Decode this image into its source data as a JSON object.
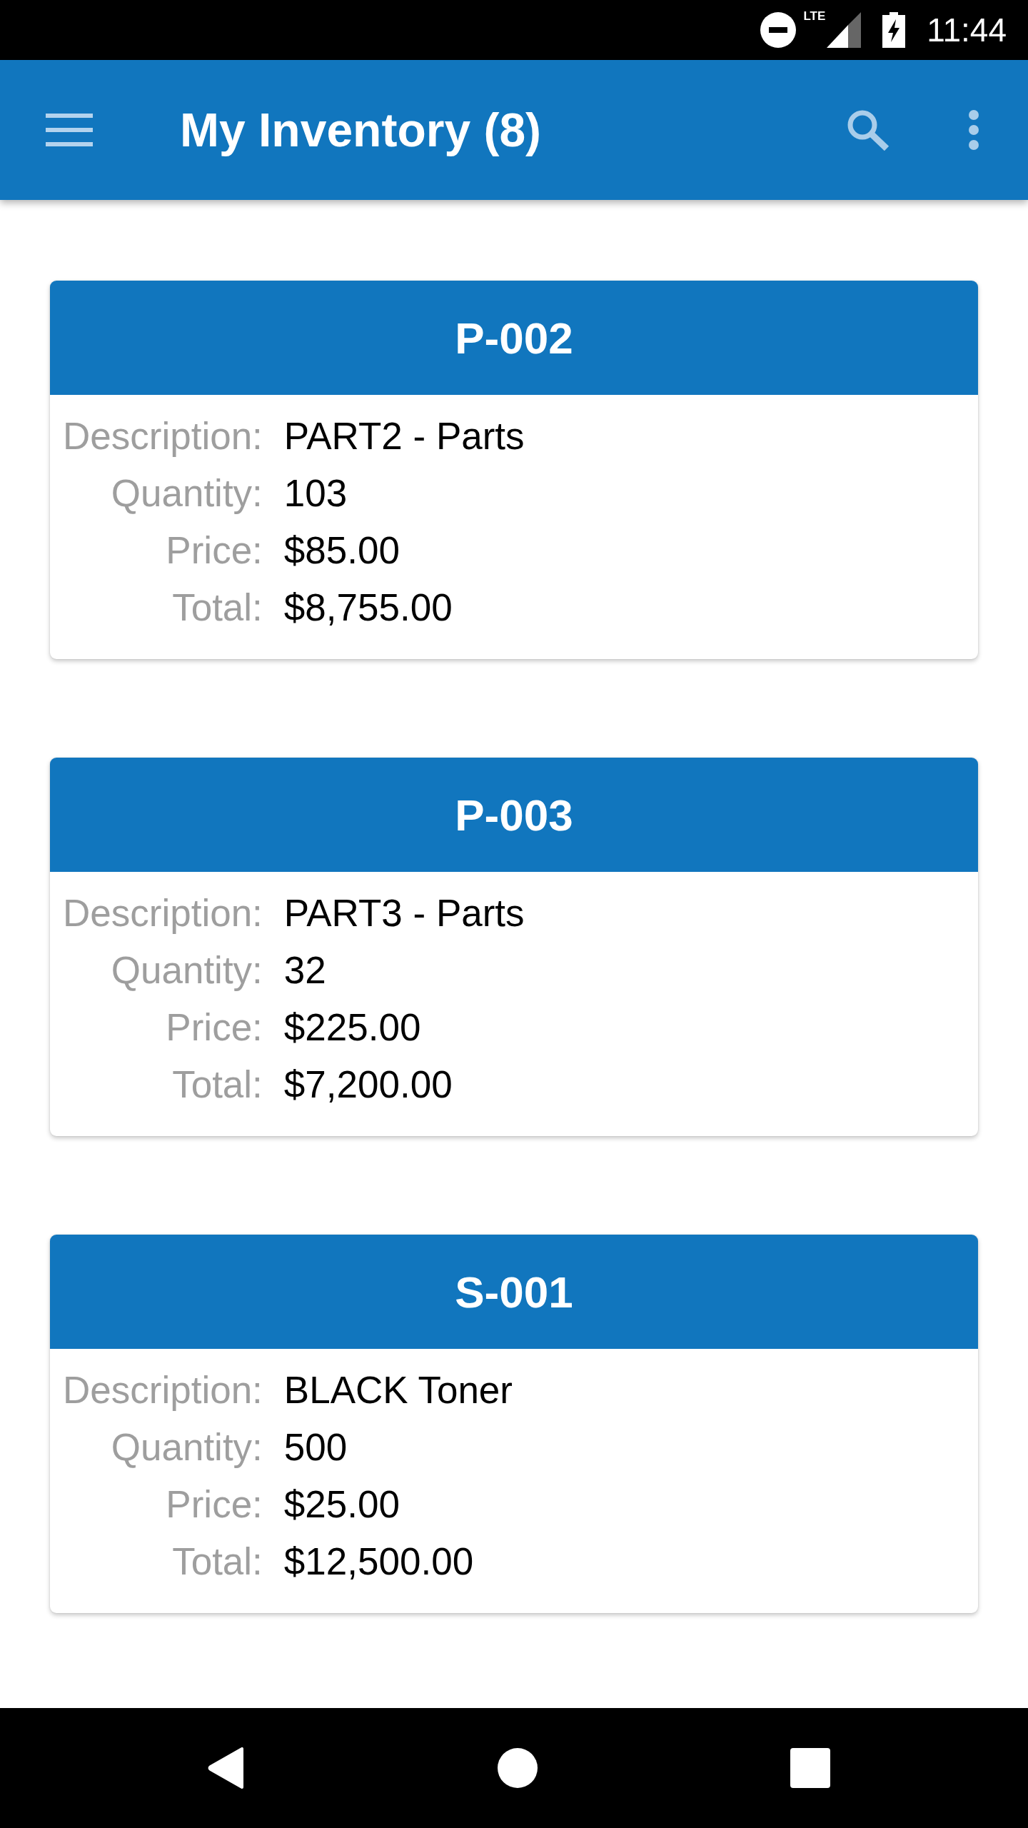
{
  "status_bar": {
    "network_label": "LTE",
    "time": "11:44"
  },
  "app_bar": {
    "title": "My Inventory (8)"
  },
  "items": [
    {
      "code": "P-002",
      "fields": [
        {
          "label": "Description:",
          "value": "PART2 - Parts"
        },
        {
          "label": "Quantity:",
          "value": "103"
        },
        {
          "label": "Price:",
          "value": "$85.00"
        },
        {
          "label": "Total:",
          "value": "$8,755.00"
        }
      ]
    },
    {
      "code": "P-003",
      "fields": [
        {
          "label": "Description:",
          "value": "PART3 - Parts"
        },
        {
          "label": "Quantity:",
          "value": "32"
        },
        {
          "label": "Price:",
          "value": "$225.00"
        },
        {
          "label": "Total:",
          "value": "$7,200.00"
        }
      ]
    },
    {
      "code": "S-001",
      "fields": [
        {
          "label": "Description:",
          "value": "BLACK Toner"
        },
        {
          "label": "Quantity:",
          "value": "500"
        },
        {
          "label": "Price:",
          "value": "$25.00"
        },
        {
          "label": "Total:",
          "value": "$12,500.00"
        }
      ]
    }
  ]
}
